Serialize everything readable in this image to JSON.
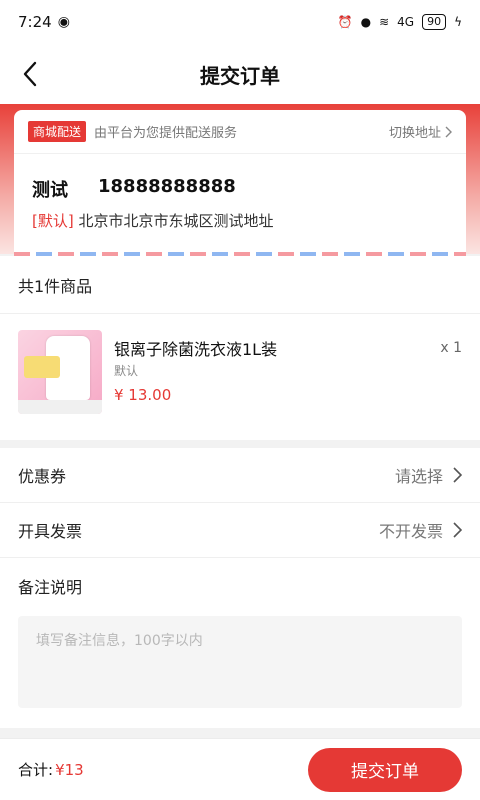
{
  "status_bar": {
    "time": "7:24",
    "battery": "90",
    "signal_label": "4G"
  },
  "nav": {
    "title": "提交订单"
  },
  "address": {
    "delivery_tag": "商城配送",
    "delivery_desc": "由平台为您提供配送服务",
    "switch_label": "切换地址",
    "name": "测试",
    "phone": "18888888888",
    "default_tag": "[默认]",
    "detail": "北京市北京市东城区测试地址"
  },
  "goods": {
    "count_label": "共1件商品",
    "items": [
      {
        "name": "银离子除菌洗衣液1L装",
        "spec": "默认",
        "price": "¥ 13.00",
        "qty": "x 1"
      }
    ]
  },
  "options": {
    "coupon_label": "优惠券",
    "coupon_value": "请选择",
    "invoice_label": "开具发票",
    "invoice_value": "不开发票",
    "note_label": "备注说明",
    "note_placeholder": "填写备注信息，100字以内"
  },
  "footer": {
    "total_label": "合计:",
    "total_value": "¥13",
    "submit_label": "提交订单"
  },
  "colors": {
    "accent": "#e53935",
    "page_bg": "#f2f2f2"
  }
}
